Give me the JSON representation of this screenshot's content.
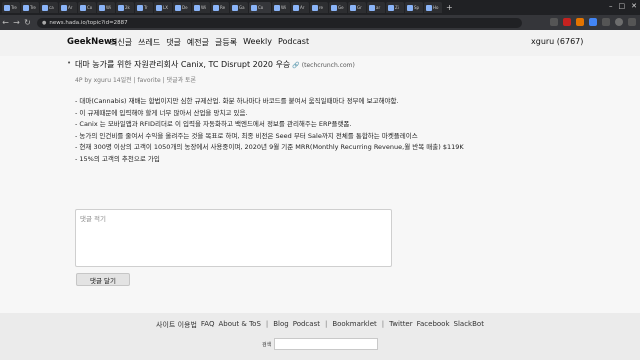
{
  "browser": {
    "tabs": [
      "Tre",
      "Tre",
      "ca",
      "Ar",
      "Co",
      "Wi",
      "2k",
      "Tr",
      "LX",
      "De",
      "Wi",
      "Re",
      "Ga",
      "Co",
      "Wi",
      "Ar",
      "re",
      "Ge",
      "Gr",
      "ar",
      "Zi",
      "Sp",
      "Ho"
    ],
    "url": "news.hada.io/topic?id=2887"
  },
  "site": {
    "brand": "GeekNews",
    "nav": [
      "최신글",
      "쓰레드",
      "댓글",
      "예전글",
      "글등록",
      "Weekly",
      "Podcast"
    ],
    "user": "xguru (6767)"
  },
  "topic": {
    "title": "대마 농가를 위한 자원관리회사 Canix, TC Disrupt 2020 우승",
    "domain": "(techcrunch.com)",
    "meta": {
      "points_by": "4P by xguru 14일전",
      "favorite": "favorite",
      "comments": "댓글과 토론"
    },
    "lines": [
      "- 대마(Cannabis) 재배는 합법이지만 심한 규제산업. 화분 하나마다 바코드를 붙여서 움직일때마다 정부에 보고해야함.",
      "- 이 규제때문에 입력해야 할게 너무 많아서 산업을 망치고 있음.",
      "- Canix 는 모바일앱과 RFID리더로 이 입력을 자동화하고 백엔드에서 정보를 관리해주는 ERP플랫폼.",
      "- 농가의 인건비를 줄여서 수익을 올려주는 것을 목표로 하며, 최종 비전은 Seed 부터 Sale까지 전체를 통합하는 마켓플레이스",
      "- 현재 300명 이상의 고객이 1050개의 농장에서 사용중이며, 2020년 9월 기준 MRR(Monthly Recurring Revenue,월 반복 매출) $119K",
      "- 15%의 고객의 추천으로 가입"
    ]
  },
  "comment": {
    "placeholder": "댓글 적기",
    "submit": "댓글 달기"
  },
  "footer": {
    "links": [
      "사이트 이용법",
      "FAQ",
      "About & ToS",
      "Blog",
      "Podcast",
      "Bookmarklet",
      "Twitter",
      "Facebook",
      "SlackBot"
    ],
    "search_label": "검색"
  }
}
